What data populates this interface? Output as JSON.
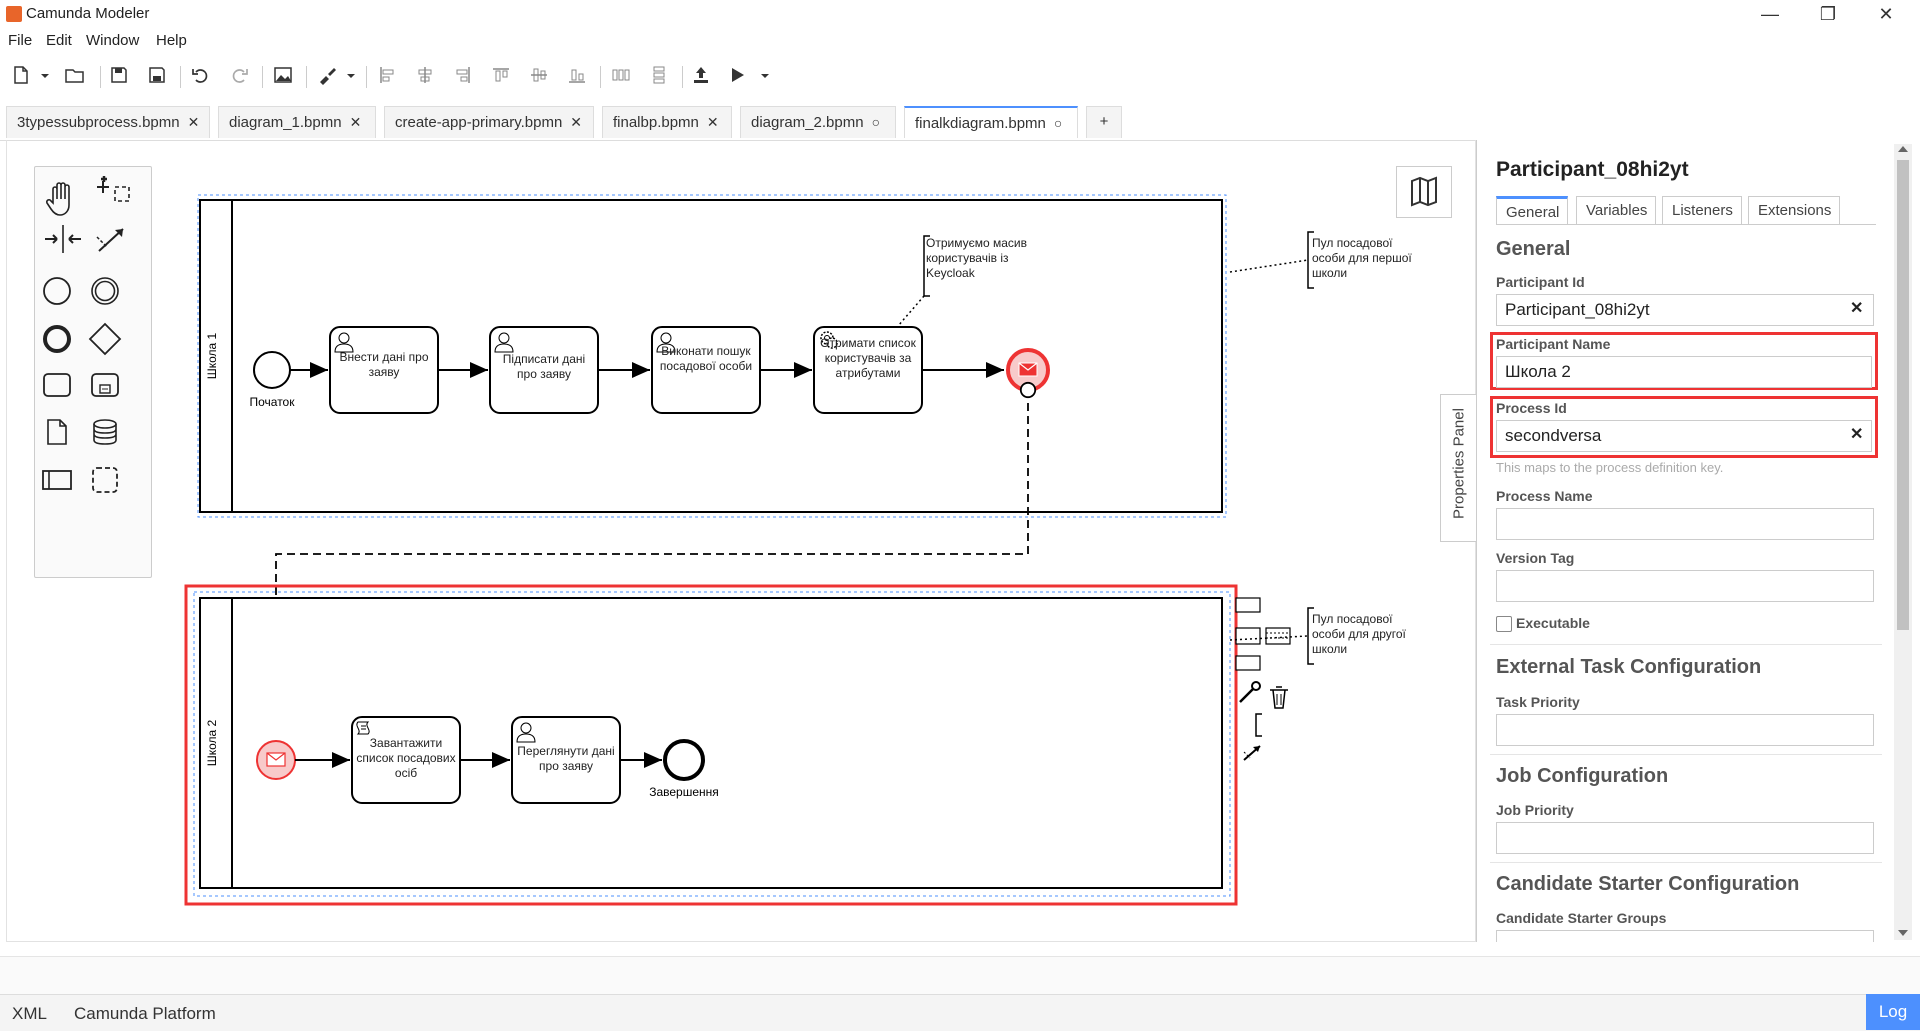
{
  "window": {
    "title": "Camunda Modeler",
    "minimize": "—",
    "maximize": "❐",
    "close": "✕"
  },
  "menu": [
    "File",
    "Edit",
    "Window",
    "Help"
  ],
  "tabs": [
    {
      "label": "3typessubprocess.bpmn",
      "mark": "✕"
    },
    {
      "label": "diagram_1.bpmn",
      "mark": "✕"
    },
    {
      "label": "create-app-primary.bpmn",
      "mark": "✕"
    },
    {
      "label": "finalbp.bpmn",
      "mark": "✕"
    },
    {
      "label": "diagram_2.bpmn",
      "mark": "○"
    },
    {
      "label": "finalkdiagram.bpmn",
      "mark": "○"
    }
  ],
  "add_tab": "+",
  "diagram": {
    "pool1": {
      "label": "Школа 1",
      "start_label": "Початок",
      "task1": "Внести дані про заяву",
      "task2": "Підписати дані про заяву",
      "task3": "Виконати пошук посадової особи",
      "task4": "Отримати список користувачів за атрибутами",
      "annotation": "Отримуємо масив користувачів із Keycloak",
      "pool_annotation": "Пул посадової особи для першої школи"
    },
    "pool2": {
      "label": "Школа 2",
      "task1": "Завантажити список посадових осіб",
      "task2": "Переглянути дані про заяву",
      "end_label": "Завершення",
      "pool_annotation": "Пул посадової особи для другої школи"
    }
  },
  "properties": {
    "toggle_label": "Properties Panel",
    "title": "Participant_08hi2yt",
    "tabs": [
      "General",
      "Variables",
      "Listeners",
      "Extensions"
    ],
    "section_general": "General",
    "participant_id_label": "Participant Id",
    "participant_id_value": "Participant_08hi2yt",
    "participant_name_label": "Participant Name",
    "participant_name_value": "Школа 2",
    "process_id_label": "Process Id",
    "process_id_value": "secondversa",
    "process_id_hint": "This maps to the process definition key.",
    "process_name_label": "Process Name",
    "process_name_value": "",
    "version_tag_label": "Version Tag",
    "version_tag_value": "",
    "executable_label": "Executable",
    "section_external": "External Task Configuration",
    "task_priority_label": "Task Priority",
    "section_job": "Job Configuration",
    "job_priority_label": "Job Priority",
    "section_candidate": "Candidate Starter Configuration",
    "candidate_groups_label": "Candidate Starter Groups",
    "clear": "✕"
  },
  "status": {
    "xml": "XML",
    "platform": "Camunda Platform",
    "log": "Log"
  },
  "colors": {
    "accent": "#4d90fe",
    "highlight": "#e33333",
    "message_event": "#e33333"
  }
}
